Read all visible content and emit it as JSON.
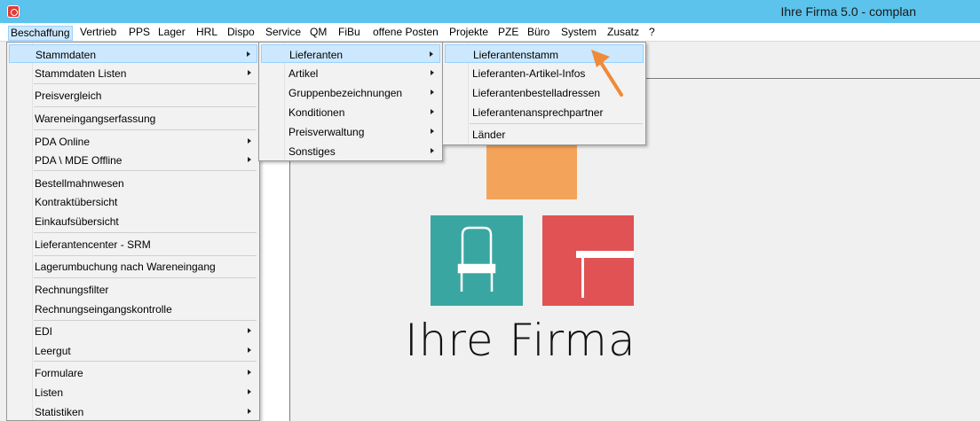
{
  "window": {
    "title": "Ihre Firma 5.0  - complan"
  },
  "menubar": {
    "items": [
      {
        "label": "Beschaffung"
      },
      {
        "label": "Vertrieb"
      },
      {
        "label": "PPS"
      },
      {
        "label": "Lager"
      },
      {
        "label": "HRL"
      },
      {
        "label": "Dispo"
      },
      {
        "label": "Service"
      },
      {
        "label": "QM"
      },
      {
        "label": "FiBu"
      },
      {
        "label": "offene Posten"
      },
      {
        "label": "Projekte"
      },
      {
        "label": "PZE"
      },
      {
        "label": "Büro"
      },
      {
        "label": "System"
      },
      {
        "label": "Zusatz"
      },
      {
        "label": "?"
      }
    ]
  },
  "menu_beschaffung": {
    "items": [
      {
        "label": "Stammdaten"
      },
      {
        "label": "Stammdaten Listen"
      },
      {
        "label": "Preisvergleich"
      },
      {
        "label": "Wareneingangserfassung"
      },
      {
        "label": "PDA Online"
      },
      {
        "label": "PDA \\ MDE Offline"
      },
      {
        "label": "Bestellmahnwesen"
      },
      {
        "label": "Kontraktübersicht"
      },
      {
        "label": "Einkaufsübersicht"
      },
      {
        "label": "Lieferantencenter - SRM"
      },
      {
        "label": "Lagerumbuchung nach Wareneingang"
      },
      {
        "label": "Rechnungsfilter"
      },
      {
        "label": "Rechnungseingangskontrolle"
      },
      {
        "label": "EDI"
      },
      {
        "label": "Leergut"
      },
      {
        "label": "Formulare"
      },
      {
        "label": "Listen"
      },
      {
        "label": "Statistiken"
      }
    ]
  },
  "menu_stammdaten": {
    "items": [
      {
        "label": "Lieferanten"
      },
      {
        "label": "Artikel"
      },
      {
        "label": "Gruppenbezeichnungen"
      },
      {
        "label": "Konditionen"
      },
      {
        "label": "Preisverwaltung"
      },
      {
        "label": "Sonstiges"
      }
    ]
  },
  "menu_lieferanten": {
    "items": [
      {
        "label": "Lieferantenstamm"
      },
      {
        "label": "Lieferanten-Artikel-Infos"
      },
      {
        "label": "Lieferantenbestelladressen"
      },
      {
        "label": "Lieferantenansprechpartner"
      },
      {
        "label": "Länder"
      }
    ]
  },
  "logo": {
    "text": "Ihre Firma"
  },
  "colors": {
    "titlebar": "#5bc3ec",
    "menu_highlight": "#cce8ff",
    "menu_highlight_border": "#99d1ff",
    "logo_orange": "#f4a45a",
    "logo_teal": "#3aa6a1",
    "logo_red": "#e05253",
    "arrow": "#ef8a38"
  }
}
